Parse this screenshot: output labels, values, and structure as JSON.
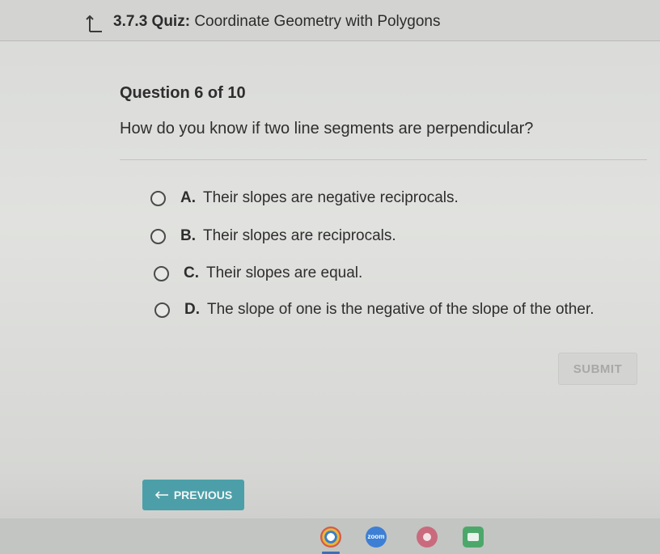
{
  "header": {
    "quiz_number": "3.7.3",
    "quiz_type": "Quiz:",
    "quiz_title": "Coordinate Geometry with Polygons",
    "back_icon": "return-up-arrow-icon"
  },
  "question": {
    "number_label": "Question 6 of 10",
    "text": "How do you know if two line segments are perpendicular?"
  },
  "options": [
    {
      "letter": "A.",
      "text": "Their slopes are negative reciprocals."
    },
    {
      "letter": "B.",
      "text": "Their slopes are reciprocals."
    },
    {
      "letter": "C.",
      "text": "Their slopes are equal."
    },
    {
      "letter": "D.",
      "text": "The slope of one is the negative of the slope of the other."
    }
  ],
  "buttons": {
    "submit_label": "SUBMIT",
    "previous_label": "PREVIOUS"
  },
  "taskbar": {
    "zoom_label": "zoom",
    "icons": [
      "chrome-icon",
      "zoom-icon",
      "app-icon",
      "classroom-icon"
    ]
  },
  "colors": {
    "accent": "#4c9fa8",
    "background": "#dcddda",
    "submit_disabled_text": "#a8a9a6"
  }
}
